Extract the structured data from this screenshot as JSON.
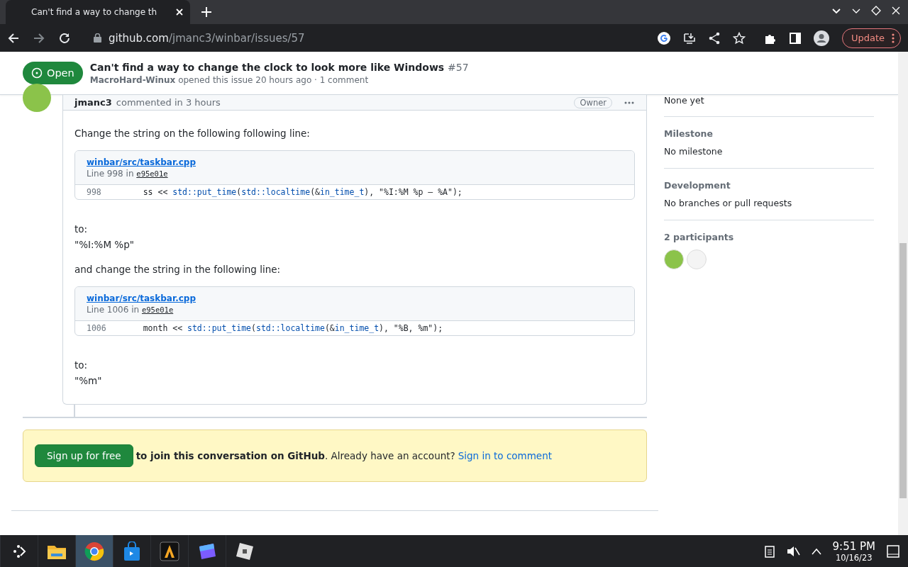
{
  "browser": {
    "tab": {
      "title": "Can't find a way to change th",
      "selected": true
    },
    "url": {
      "host": "github.com",
      "path": "/jmanc3/winbar/issues/57"
    },
    "update_label": "Update"
  },
  "issue": {
    "state": "Open",
    "title": "Can't find a way to change the clock to look more like Windows",
    "number": "#57",
    "author": "MacroHard-Winux",
    "meta": "opened this issue 20 hours ago · 1 comment"
  },
  "comment": {
    "author": "jmanc3",
    "action": "commented in 3 hours",
    "role": "Owner",
    "blocks": [
      {
        "kind": "text",
        "text": "Change the string on the following following line:"
      },
      {
        "kind": "code",
        "file": "winbar/src/taskbar.cpp",
        "line_label": "Line 998 in",
        "commit": "e95e01e",
        "line_number": "998",
        "segments": [
          {
            "text": "    ss << ",
            "kind": "plain"
          },
          {
            "text": "std::put_time",
            "kind": "entity"
          },
          {
            "text": "(",
            "kind": "plain"
          },
          {
            "text": "std::localtime",
            "kind": "entity"
          },
          {
            "text": "(&",
            "kind": "plain"
          },
          {
            "text": "in_time_t",
            "kind": "entity"
          },
          {
            "text": "), \"%I:%M %p — %A\");",
            "kind": "plain"
          }
        ]
      },
      {
        "kind": "lines",
        "lines": [
          "to:",
          "\"%I:%M %p\""
        ]
      },
      {
        "kind": "text",
        "text": "and change the string in the following line:"
      },
      {
        "kind": "code",
        "file": "winbar/src/taskbar.cpp",
        "line_label": "Line 1006 in",
        "commit": "e95e01e",
        "line_number": "1006",
        "segments": [
          {
            "text": "    month << ",
            "kind": "plain"
          },
          {
            "text": "std::put_time",
            "kind": "entity"
          },
          {
            "text": "(",
            "kind": "plain"
          },
          {
            "text": "std::localtime",
            "kind": "entity"
          },
          {
            "text": "(&",
            "kind": "plain"
          },
          {
            "text": "in_time_t",
            "kind": "entity"
          },
          {
            "text": "), \"%B, %m\");",
            "kind": "plain"
          }
        ]
      },
      {
        "kind": "lines",
        "lines": [
          "to:",
          "\"%m\""
        ]
      }
    ]
  },
  "signup": {
    "button": "Sign up for free",
    "bold": "to join this conversation on GitHub",
    "text": ". Already have an account?",
    "link": "Sign in to comment"
  },
  "sidebar": {
    "top_value": "None yet",
    "sections": [
      {
        "heading": "Milestone",
        "value": "No milestone"
      },
      {
        "heading": "Development",
        "value": "No branches or pull requests"
      }
    ],
    "participants_heading": "2 participants",
    "participants": [
      {
        "color": "#8bc34a"
      },
      {
        "color": "#f4f4f4"
      }
    ]
  },
  "taskbar": {
    "apps": [
      {
        "kind": "folder",
        "selected": false
      },
      {
        "kind": "chrome",
        "selected": true
      },
      {
        "kind": "store",
        "selected": false
      },
      {
        "kind": "editor",
        "selected": false
      },
      {
        "kind": "purple",
        "selected": false
      },
      {
        "kind": "roblox",
        "selected": false
      }
    ],
    "time": "9:51 PM",
    "date": "10/16/23"
  }
}
